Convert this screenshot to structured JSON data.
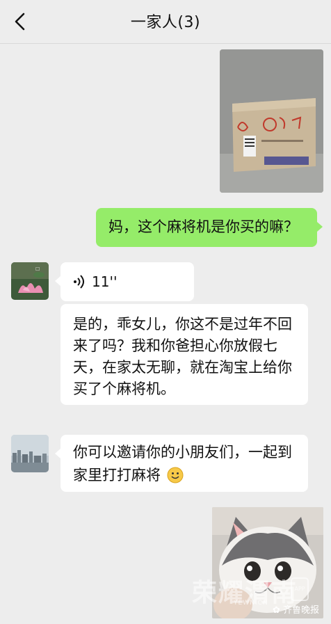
{
  "header": {
    "title": "一家人(3)"
  },
  "messages": {
    "m1_text": "妈，这个麻将机是你买的嘛？",
    "voice_duration": "11''",
    "m3_text": "是的，乖女儿，你这不是过年不回来了吗？我和你爸担心你放假七天，在家太无聊，就在淘宝上给你买了个麻将机。",
    "m4_text": "你可以邀请你的小朋友们，一起到家里打打麻将"
  },
  "watermark": {
    "brand": "荣耀渭南",
    "url": "YEWN.CN",
    "app_label": "APP",
    "source": "齐鲁晚报"
  },
  "colors": {
    "background": "#ededed",
    "my_bubble": "#95ec69",
    "other_bubble": "#ffffff"
  },
  "icons": [
    "chevron-left-icon",
    "voice-icon",
    "smile-emoji-icon"
  ]
}
